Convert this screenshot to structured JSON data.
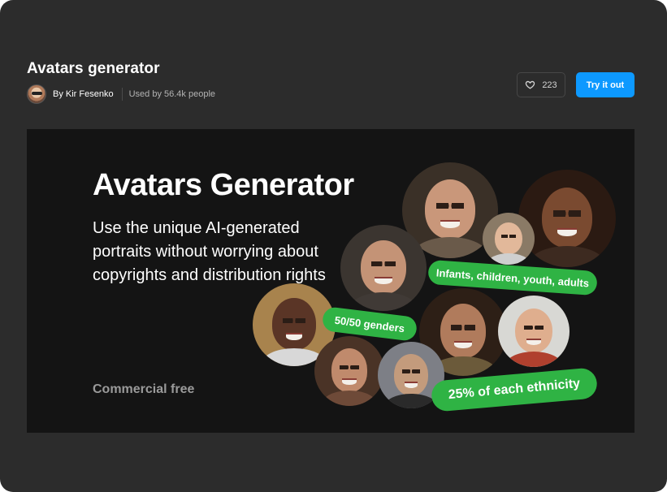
{
  "header": {
    "title": "Avatars generator",
    "author": "By Kir Fesenko",
    "usage": "Used by 56.4k people",
    "likes": "223",
    "try_label": "Try it out"
  },
  "banner": {
    "title": "Avatars Generator",
    "subtitle": "Use the unique AI-generated portraits without worrying about copyrights and distribution rights",
    "footer": "Commercial free",
    "tags": {
      "ages": "Infants, children, youth, adults",
      "genders": "50/50 genders",
      "ethnicity": "25% of each ethnicity"
    },
    "colors": {
      "tag_green": "#2fb344",
      "accent_blue": "#0d99ff"
    }
  }
}
